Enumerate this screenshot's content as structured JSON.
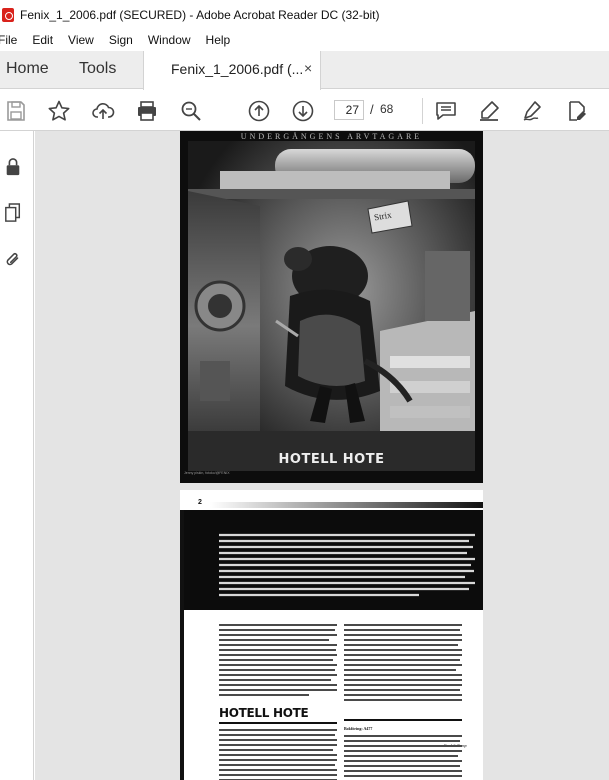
{
  "window": {
    "title": "Fenix_1_2006.pdf (SECURED) - Adobe Acrobat Reader DC (32-bit)"
  },
  "menu": {
    "items": [
      "File",
      "Edit",
      "View",
      "Sign",
      "Window",
      "Help"
    ]
  },
  "tabs": {
    "home": "Home",
    "tools": "Tools",
    "document": "Fenix_1_2006.pdf (...",
    "close_glyph": "×"
  },
  "toolbar": {
    "icons": [
      "save-icon",
      "bookmark-star-icon",
      "cloud-upload-icon",
      "print-icon",
      "zoom-search-icon",
      "page-up-icon",
      "page-down-icon",
      "comment-icon",
      "highlight-pen-icon",
      "fill-sign-icon",
      "edit-pdf-icon"
    ],
    "current_page": "27",
    "page_separator": "/",
    "total_pages": "68"
  },
  "left_rail": {
    "icons": [
      "lock-icon",
      "pages-icon",
      "attachment-icon",
      "collapse-panel-icon"
    ]
  },
  "document": {
    "cover_heading": "UNDERGÅNGENS ARVTAGARE",
    "cover_title": "HOTELL HOTE",
    "cover_sign": "Strix",
    "cover_credit": "Jenny piskin, fotoko/@FENIX",
    "page2_number": "2",
    "page2_heading": "HOTELL HOTE",
    "page2_signoff": "Fredrik Kamp",
    "page2_subhead": "Bokföring: A477"
  },
  "colors": {
    "acrobat_red": "#d9221b",
    "tab_bar": "#ededed",
    "doc_bg": "#e4e4e4",
    "icon_gray": "#555555"
  }
}
